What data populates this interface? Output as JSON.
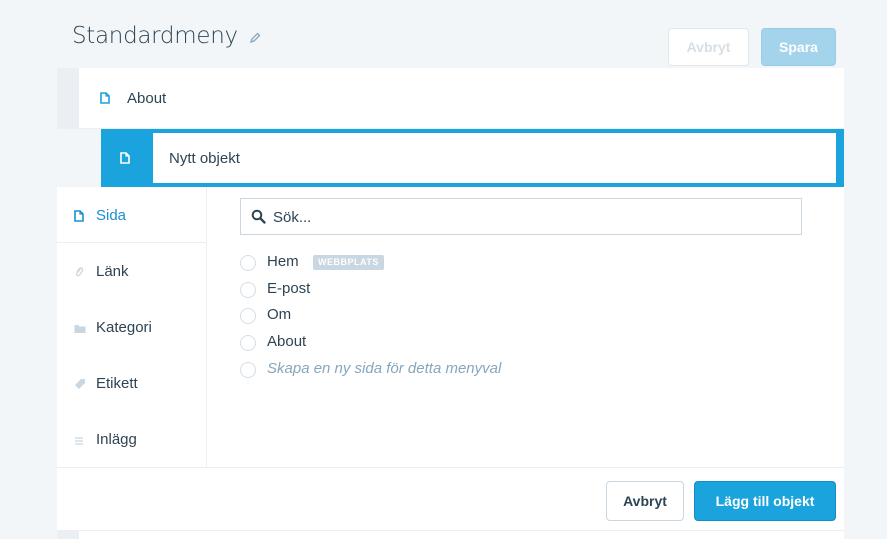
{
  "header": {
    "title": "Standardmeny",
    "title_icon": "pencil-icon",
    "cancel_label": "Avbryt",
    "save_label": "Spara"
  },
  "menu_items": [
    {
      "label": "About",
      "icon": "page-icon"
    }
  ],
  "new_item": {
    "label": "Nytt objekt",
    "icon": "page-icon"
  },
  "sidebar": {
    "items": [
      {
        "label": "Sida",
        "icon": "page-icon",
        "active": true
      },
      {
        "label": "Länk",
        "icon": "link-icon"
      },
      {
        "label": "Kategori",
        "icon": "folder-icon"
      },
      {
        "label": "Etikett",
        "icon": "tag-icon"
      },
      {
        "label": "Inlägg",
        "icon": "lines-icon"
      }
    ]
  },
  "search": {
    "placeholder": "Sök...",
    "value": ""
  },
  "options": [
    {
      "label": "Hem",
      "badge": "WEBBPLATS"
    },
    {
      "label": "E-post"
    },
    {
      "label": "Om"
    },
    {
      "label": "About"
    },
    {
      "label": "Skapa en ny sida för detta menyval"
    }
  ],
  "footer": {
    "cancel_label": "Avbryt",
    "add_label": "Lägg till objekt"
  },
  "colors": {
    "accent": "#1aa3dc",
    "text": "#2e4453",
    "muted": "#87a6bc",
    "border": "#c8d7e1"
  }
}
